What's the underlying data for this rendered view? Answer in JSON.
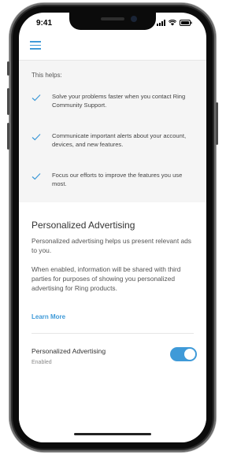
{
  "status_bar": {
    "time": "9:41"
  },
  "colors": {
    "accent": "#3f9ad8",
    "section_bg": "#f5f5f5"
  },
  "header": {
    "menu_icon": "hamburger-menu-icon"
  },
  "helps": {
    "title": "This helps:",
    "items": [
      {
        "icon": "checkmark-icon",
        "text": "Solve your problems faster when you contact Ring Community Support."
      },
      {
        "icon": "checkmark-icon",
        "text": "Communicate important alerts about your account, devices, and new features."
      },
      {
        "icon": "checkmark-icon",
        "text": "Focus our efforts to improve the features you use most."
      }
    ]
  },
  "ads": {
    "title": "Personalized Advertising",
    "description": "Personalized advertising helps us present relevant ads to you.",
    "description2": "When enabled, information will be shared with third parties for purposes of showing you personalized advertising for Ring products.",
    "learn_more": "Learn More",
    "toggle_label": "Personalized Advertising",
    "toggle_status": "Enabled",
    "toggle_on": true
  }
}
